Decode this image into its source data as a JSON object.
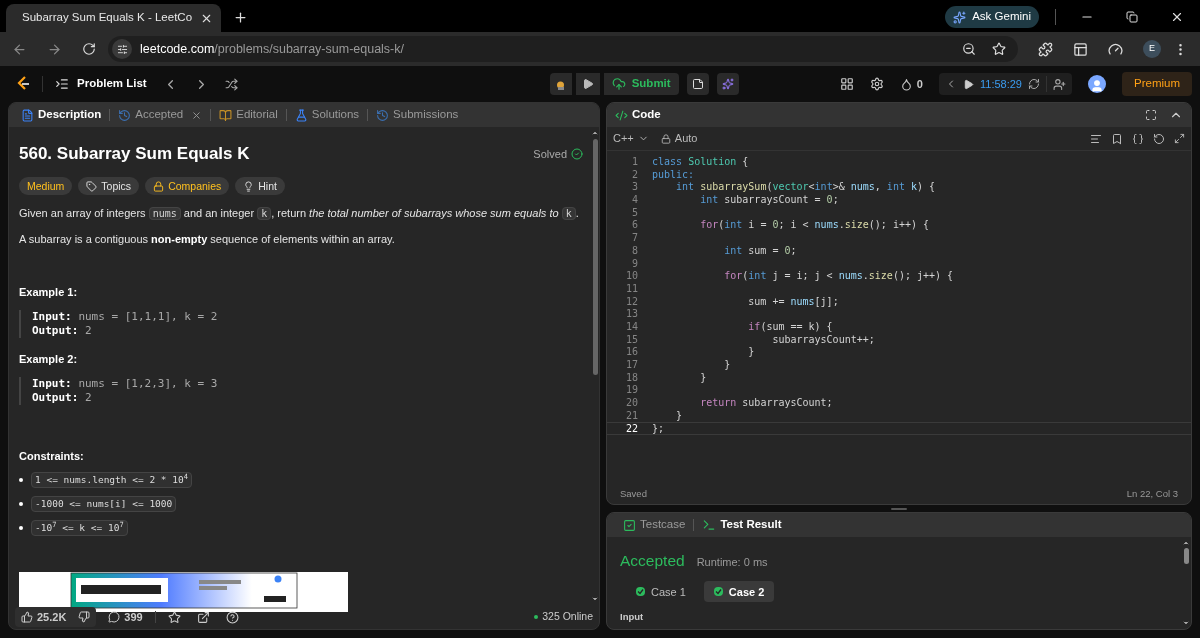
{
  "browser": {
    "tab_title": "Subarray Sum Equals K - LeetCo",
    "url_host": "leetcode.com",
    "url_path": "/problems/subarray-sum-equals-k/",
    "gemini": "Ask Gemini",
    "profile": "E"
  },
  "nav": {
    "problem_list": "Problem List",
    "submit": "Submit",
    "streak": "0",
    "timer": "11:58:29",
    "premium": "Premium"
  },
  "left_tabs": [
    {
      "label": "Description",
      "selected": true,
      "kind": "description"
    },
    {
      "label": "Accepted",
      "selected": false,
      "kind": "accepted",
      "closable": true
    },
    {
      "label": "Editorial",
      "selected": false,
      "kind": "editorial"
    },
    {
      "label": "Solutions",
      "selected": false,
      "kind": "solutions"
    },
    {
      "label": "Submissions",
      "selected": false,
      "kind": "submissions"
    }
  ],
  "problem": {
    "title": "560. Subarray Sum Equals K",
    "status": "Solved",
    "tags": [
      {
        "label": "Medium",
        "kind": "difficulty"
      },
      {
        "label": "Topics",
        "kind": "topics"
      },
      {
        "label": "Companies",
        "kind": "companies"
      },
      {
        "label": "Hint",
        "kind": "hint"
      }
    ],
    "paragraphs": [
      [
        {
          "t": "Given an array of integers ",
          "kind": "text"
        },
        {
          "t": "nums",
          "kind": "code"
        },
        {
          "t": " and an integer ",
          "kind": "text"
        },
        {
          "t": "k",
          "kind": "code"
        },
        {
          "t": ", return ",
          "kind": "text"
        },
        {
          "t": "the total number of subarrays whose sum equals to ",
          "kind": "italic"
        },
        {
          "t": "k",
          "kind": "code"
        },
        {
          "t": ".",
          "kind": "text"
        }
      ],
      [
        {
          "t": "A subarray is a contiguous ",
          "kind": "text"
        },
        {
          "t": "non-empty",
          "kind": "bold"
        },
        {
          "t": " sequence of elements within an array.",
          "kind": "text"
        }
      ]
    ],
    "examples": [
      {
        "heading": "Example 1:",
        "lines": [
          {
            "label": "Input:",
            "value": "nums = [1,1,1], k = 2"
          },
          {
            "label": "Output:",
            "value": "2"
          }
        ]
      },
      {
        "heading": "Example 2:",
        "lines": [
          {
            "label": "Input:",
            "value": "nums = [1,2,3], k = 3"
          },
          {
            "label": "Output:",
            "value": "2"
          }
        ]
      }
    ],
    "constraints_heading": "Constraints:",
    "constraints": [
      "1 <= nums.length <= 2 * 10$^{4}$",
      "-1000 <= nums[i] <= 1000",
      "-10$^{7}$ <= k <= 10$^{7}$"
    ],
    "ad": {
      "kind": "picture"
    }
  },
  "footer": {
    "likes": "25.2K",
    "comments": "399",
    "online": "325 Online"
  },
  "code_panel": {
    "title": "Code",
    "language": "C++",
    "mode": "Auto",
    "status": "Saved",
    "cursor": "Ln 22, Col 3",
    "lines": [
      {
        "n": "1",
        "current": false,
        "tokens": [
          {
            "t": "class",
            "kind": "kw"
          },
          {
            "t": " Solution",
            "kind": "cls"
          },
          {
            "t": " {",
            "kind": "plain"
          }
        ]
      },
      {
        "n": "2",
        "current": false,
        "tokens": [
          {
            "t": "public:",
            "kind": "kw"
          }
        ]
      },
      {
        "n": "3",
        "current": false,
        "tokens": [
          {
            "t": "    int",
            "kind": "kw"
          },
          {
            "t": " subarraySum",
            "kind": "fn"
          },
          {
            "t": "(",
            "kind": "plain"
          },
          {
            "t": "vector",
            "kind": "cls"
          },
          {
            "t": "<",
            "kind": "plain"
          },
          {
            "t": "int",
            "kind": "kw"
          },
          {
            "t": ">& ",
            "kind": "plain"
          },
          {
            "t": "nums",
            "kind": "var"
          },
          {
            "t": ", ",
            "kind": "plain"
          },
          {
            "t": "int",
            "kind": "kw"
          },
          {
            "t": " k",
            "kind": "var"
          },
          {
            "t": ") {",
            "kind": "plain"
          }
        ]
      },
      {
        "n": "4",
        "current": false,
        "tokens": [
          {
            "t": "        int",
            "kind": "kw"
          },
          {
            "t": " subarraysCount = ",
            "kind": "plain"
          },
          {
            "t": "0",
            "kind": "num"
          },
          {
            "t": ";",
            "kind": "plain"
          }
        ]
      },
      {
        "n": "5",
        "current": false
      },
      {
        "n": "6",
        "current": false,
        "tokens": [
          {
            "t": "        for",
            "kind": "ctl"
          },
          {
            "t": "(",
            "kind": "plain"
          },
          {
            "t": "int",
            "kind": "kw"
          },
          {
            "t": " i = ",
            "kind": "plain"
          },
          {
            "t": "0",
            "kind": "num"
          },
          {
            "t": "; i < ",
            "kind": "plain"
          },
          {
            "t": "nums",
            "kind": "var"
          },
          {
            "t": ".",
            "kind": "plain"
          },
          {
            "t": "size",
            "kind": "fn"
          },
          {
            "t": "(); i++) {",
            "kind": "plain"
          }
        ]
      },
      {
        "n": "7",
        "current": false
      },
      {
        "n": "8",
        "current": false,
        "tokens": [
          {
            "t": "            int",
            "kind": "kw"
          },
          {
            "t": " sum = ",
            "kind": "plain"
          },
          {
            "t": "0",
            "kind": "num"
          },
          {
            "t": ";",
            "kind": "plain"
          }
        ]
      },
      {
        "n": "9",
        "current": false
      },
      {
        "n": "10",
        "current": false,
        "tokens": [
          {
            "t": "            for",
            "kind": "ctl"
          },
          {
            "t": "(",
            "kind": "plain"
          },
          {
            "t": "int",
            "kind": "kw"
          },
          {
            "t": " j = i; j < ",
            "kind": "plain"
          },
          {
            "t": "nums",
            "kind": "var"
          },
          {
            "t": ".",
            "kind": "plain"
          },
          {
            "t": "size",
            "kind": "fn"
          },
          {
            "t": "(); j++) {",
            "kind": "plain"
          }
        ]
      },
      {
        "n": "11",
        "current": false
      },
      {
        "n": "12",
        "current": false,
        "tokens": [
          {
            "t": "                sum += ",
            "kind": "plain"
          },
          {
            "t": "nums",
            "kind": "var"
          },
          {
            "t": "[j];",
            "kind": "plain"
          }
        ]
      },
      {
        "n": "13",
        "current": false
      },
      {
        "n": "14",
        "current": false,
        "tokens": [
          {
            "t": "                if",
            "kind": "ctl"
          },
          {
            "t": "(sum == k) {",
            "kind": "plain"
          }
        ]
      },
      {
        "n": "15",
        "current": false,
        "tokens": [
          {
            "t": "                    subarraysCount++;",
            "kind": "plain"
          }
        ]
      },
      {
        "n": "16",
        "current": false,
        "tokens": [
          {
            "t": "                }",
            "kind": "plain"
          }
        ]
      },
      {
        "n": "17",
        "current": false,
        "tokens": [
          {
            "t": "            }",
            "kind": "plain"
          }
        ]
      },
      {
        "n": "18",
        "current": false,
        "tokens": [
          {
            "t": "        }",
            "kind": "plain"
          }
        ]
      },
      {
        "n": "19",
        "current": false
      },
      {
        "n": "20",
        "current": false,
        "tokens": [
          {
            "t": "        return",
            "kind": "ctl"
          },
          {
            "t": " subarraysCount;",
            "kind": "plain"
          }
        ]
      },
      {
        "n": "21",
        "current": false,
        "tokens": [
          {
            "t": "    }",
            "kind": "plain"
          }
        ]
      },
      {
        "n": "22",
        "current": true,
        "tokens": [
          {
            "t": "};",
            "kind": "plain"
          }
        ]
      }
    ]
  },
  "result_panel": {
    "tabs": [
      {
        "label": "Testcase",
        "selected": false,
        "kind": "testcase"
      },
      {
        "label": "Test Result",
        "selected": true,
        "kind": "result"
      }
    ],
    "verdict": "Accepted",
    "runtime": "Runtime: 0 ms",
    "cases": [
      {
        "label": "Case 1",
        "selected": false
      },
      {
        "label": "Case 2",
        "selected": true
      }
    ],
    "input_label": "Input"
  }
}
